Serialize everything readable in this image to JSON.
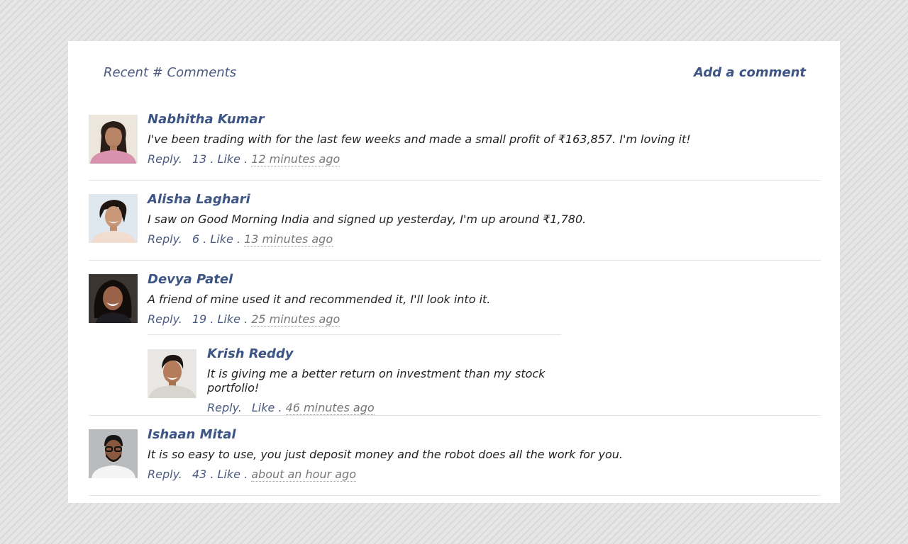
{
  "header": {
    "title": "Recent # Comments",
    "add_comment": "Add a comment"
  },
  "comments": [
    {
      "name": "Nabhitha Kumar",
      "text": "I've been trading with for the last few weeks and made a small profit of ₹163,857. I'm loving it!",
      "reply_label": "Reply.",
      "likes": "13",
      "like_label": "Like",
      "time": "12 minutes ago"
    },
    {
      "name": "Alisha Laghari",
      "text": "I saw on Good Morning India and signed up yesterday, I'm up around ₹1,780.",
      "reply_label": "Reply.",
      "likes": "6",
      "like_label": "Like",
      "time": "13 minutes ago"
    },
    {
      "name": "Devya Patel",
      "text": "A friend of mine used it and recommended it, I'll look into it.",
      "reply_label": "Reply.",
      "likes": "19",
      "like_label": "Like",
      "time": "25 minutes ago",
      "reply": {
        "name": "Krish Reddy",
        "text": "It is giving me a better return on investment than my stock portfolio!",
        "reply_label": "Reply.",
        "like_label": "Like",
        "time": "46 minutes ago"
      }
    },
    {
      "name": "Ishaan Mital",
      "text": "It is so easy to use, you just deposit money and the robot does all the work for you.",
      "reply_label": "Reply.",
      "likes": "43",
      "like_label": "Like",
      "time": "about an hour ago"
    }
  ]
}
